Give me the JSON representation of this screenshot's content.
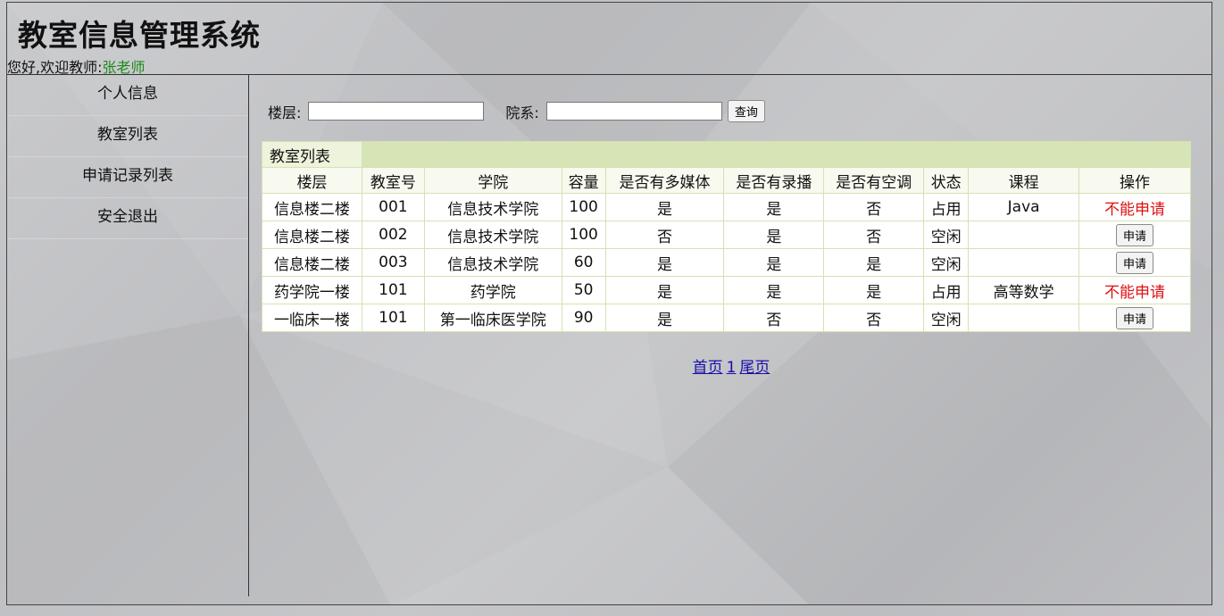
{
  "header": {
    "title": "教室信息管理系统",
    "greeting": "您好,欢迎教师:",
    "teacher_name": "张老师"
  },
  "sidebar": {
    "items": [
      {
        "label": "个人信息"
      },
      {
        "label": "教室列表"
      },
      {
        "label": "申请记录列表"
      },
      {
        "label": "安全退出"
      }
    ]
  },
  "search": {
    "floor_label": "楼层:",
    "floor_value": "",
    "dept_label": "院系:",
    "dept_value": "",
    "query_button": "查询"
  },
  "table": {
    "caption": "教室列表",
    "columns": [
      "楼层",
      "教室号",
      "学院",
      "容量",
      "是否有多媒体",
      "是否有录播",
      "是否有空调",
      "状态",
      "课程",
      "操作"
    ],
    "rows": [
      {
        "floor": "信息楼二楼",
        "room": "001",
        "college": "信息技术学院",
        "capacity": "100",
        "multimedia": "是",
        "recording": "是",
        "aircon": "否",
        "status": "占用",
        "course": "Java",
        "action": "不能申请",
        "action_type": "text"
      },
      {
        "floor": "信息楼二楼",
        "room": "002",
        "college": "信息技术学院",
        "capacity": "100",
        "multimedia": "否",
        "recording": "是",
        "aircon": "否",
        "status": "空闲",
        "course": "",
        "action": "申请",
        "action_type": "button"
      },
      {
        "floor": "信息楼二楼",
        "room": "003",
        "college": "信息技术学院",
        "capacity": "60",
        "multimedia": "是",
        "recording": "是",
        "aircon": "是",
        "status": "空闲",
        "course": "",
        "action": "申请",
        "action_type": "button"
      },
      {
        "floor": "药学院一楼",
        "room": "101",
        "college": "药学院",
        "capacity": "50",
        "multimedia": "是",
        "recording": "是",
        "aircon": "是",
        "status": "占用",
        "course": "高等数学",
        "action": "不能申请",
        "action_type": "text"
      },
      {
        "floor": "一临床一楼",
        "room": "101",
        "college": "第一临床医学院",
        "capacity": "90",
        "multimedia": "是",
        "recording": "否",
        "aircon": "否",
        "status": "空闲",
        "course": "",
        "action": "申请",
        "action_type": "button"
      }
    ]
  },
  "pager": {
    "first": "首页",
    "page": "1",
    "last": "尾页"
  },
  "colors": {
    "accent_green": "#1c8a1c",
    "deny_red": "#e01010",
    "table_header_green": "#d7e4b6",
    "link_blue": "#1a0dab"
  }
}
